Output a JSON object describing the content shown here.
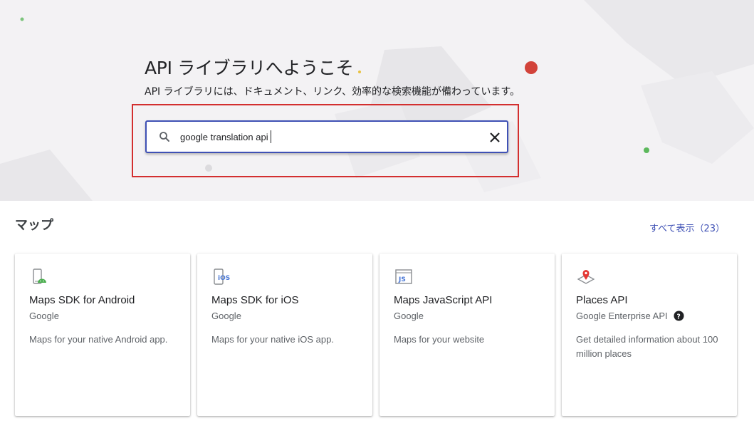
{
  "hero": {
    "title": "API ライブラリへようこそ",
    "subtitle": "API ライブラリには、ドキュメント、リンク、効率的な検索機能が備わっています。"
  },
  "search": {
    "value": "google translation api",
    "icon": "search-icon",
    "clear_icon": "close-icon"
  },
  "section": {
    "title": "マップ",
    "show_all": "すべて表示（23）"
  },
  "cards": [
    {
      "title": "Maps SDK for Android",
      "vendor": "Google",
      "description": "Maps for your native Android app.",
      "icon": "android-map-icon"
    },
    {
      "title": "Maps SDK for iOS",
      "vendor": "Google",
      "description": "Maps for your native iOS app.",
      "icon": "ios-icon"
    },
    {
      "title": "Maps JavaScript API",
      "vendor": "Google",
      "description": "Maps for your website",
      "icon": "javascript-icon"
    },
    {
      "title": "Places API",
      "vendor": "Google Enterprise API",
      "description": "Get detailed information about 100 million places",
      "icon": "map-pin-icon"
    }
  ],
  "colors": {
    "accent": "#3f51b5",
    "highlight": "#d32f2f",
    "hero_bg": "#f3f2f4"
  }
}
